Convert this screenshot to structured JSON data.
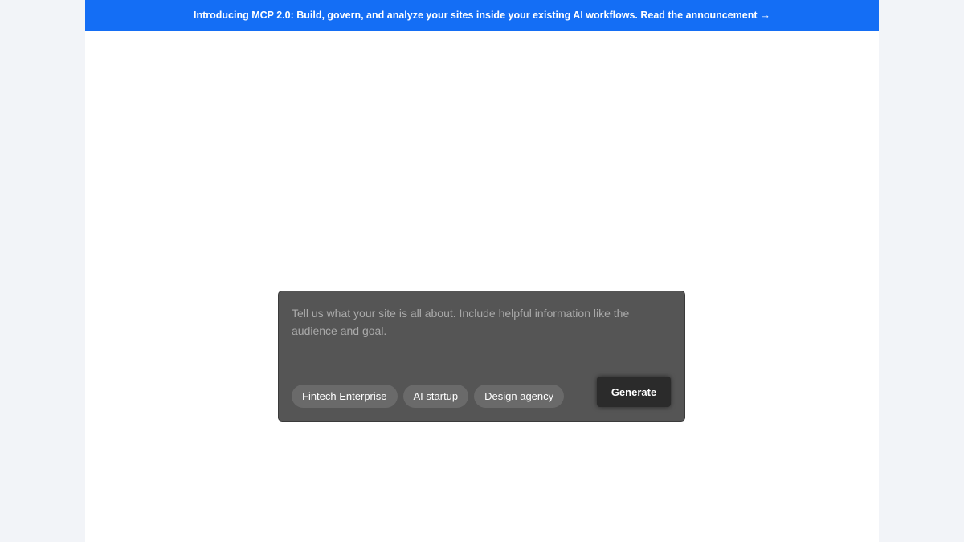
{
  "banner": {
    "text": "Introducing MCP 2.0: Build, govern, and analyze your sites inside your existing AI workflows. Read the announcement",
    "arrow": "→",
    "color": "#146ef5"
  },
  "prompt": {
    "value": "",
    "placeholder": "Tell us what your site is all about. Include helpful information like the audience and goal.",
    "chips": [
      {
        "label": "Fintech Enterprise"
      },
      {
        "label": "AI startup"
      },
      {
        "label": "Design agency"
      }
    ],
    "generate_label": "Generate"
  },
  "colors": {
    "card": "#555555",
    "chip": "#6a6a6a",
    "button": "#2b2b2b",
    "outer_background": "#f2f4f8"
  }
}
